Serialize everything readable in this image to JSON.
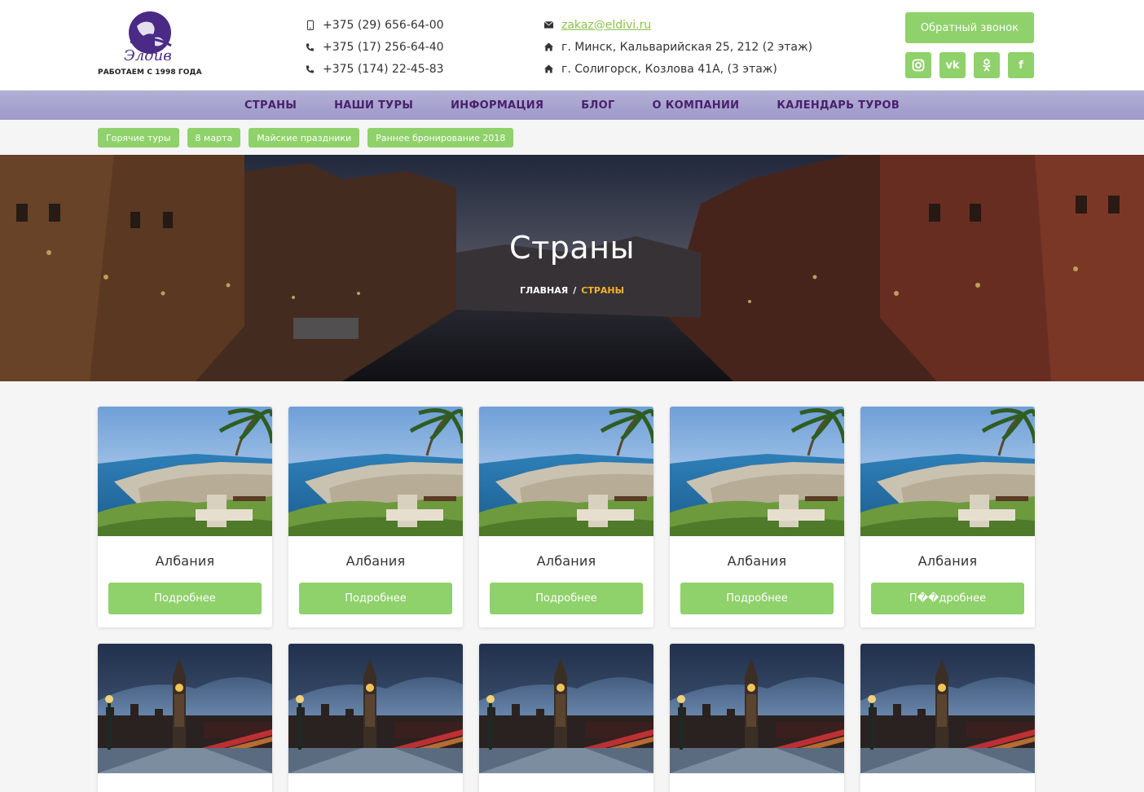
{
  "brand": {
    "tagline": "РАБОТАЕМ С 1998 ГОДА",
    "logo_text": "Элдиви",
    "colors": {
      "accent": "#8fd16a",
      "nav_bg": "#a9a5d1",
      "nav_text": "#4a1f6b",
      "brand_purple": "#4b2a86",
      "breadcrumb_active": "#f2b22c"
    }
  },
  "contacts": {
    "phones": [
      "+375 (29) 656-64-00",
      "+375 (17) 256-64-40",
      "+375 (174) 22-45-83"
    ],
    "email": "zakaz@eldivi.ru",
    "addresses": [
      "г. Минск, Кальварийская 25, 212 (2 этаж)",
      "г. Солигорск, Козлова 41А, (3 этаж)"
    ]
  },
  "header": {
    "callback_label": "Обратный звонок",
    "social": [
      {
        "icon": "instagram-icon"
      },
      {
        "icon": "vk-icon",
        "text": "vk"
      },
      {
        "icon": "odnoklassniki-icon"
      },
      {
        "icon": "facebook-icon",
        "text": "f"
      }
    ]
  },
  "nav": {
    "items": [
      "СТРАНЫ",
      "НАШИ ТУРЫ",
      "ИНФОРМАЦИЯ",
      "БЛОГ",
      "О КОМПАНИИ",
      "КАЛЕНДАРЬ ТУРОВ"
    ]
  },
  "tags": [
    "Горячие туры",
    "8 марта",
    "Майские праздники",
    "Раннее бронирование 2018"
  ],
  "hero": {
    "title": "Страны",
    "breadcrumb": {
      "home": "ГЛАВНАЯ",
      "separator": "/",
      "current": "СТРАНЫ"
    }
  },
  "cards": {
    "row1": [
      {
        "title": "Албания",
        "button": "Подробнее",
        "image": "albania-coast"
      },
      {
        "title": "Албания",
        "button": "Подробнее",
        "image": "albania-coast"
      },
      {
        "title": "Албания",
        "button": "Подробнее",
        "image": "albania-coast"
      },
      {
        "title": "Албания",
        "button": "Подробнее",
        "image": "albania-coast"
      },
      {
        "title": "Албания",
        "button": "П��дробнее",
        "image": "albania-coast"
      }
    ],
    "row2": [
      {
        "image": "london-big-ben"
      },
      {
        "image": "london-big-ben"
      },
      {
        "image": "london-big-ben"
      },
      {
        "image": "london-big-ben"
      },
      {
        "image": "london-big-ben"
      }
    ]
  }
}
